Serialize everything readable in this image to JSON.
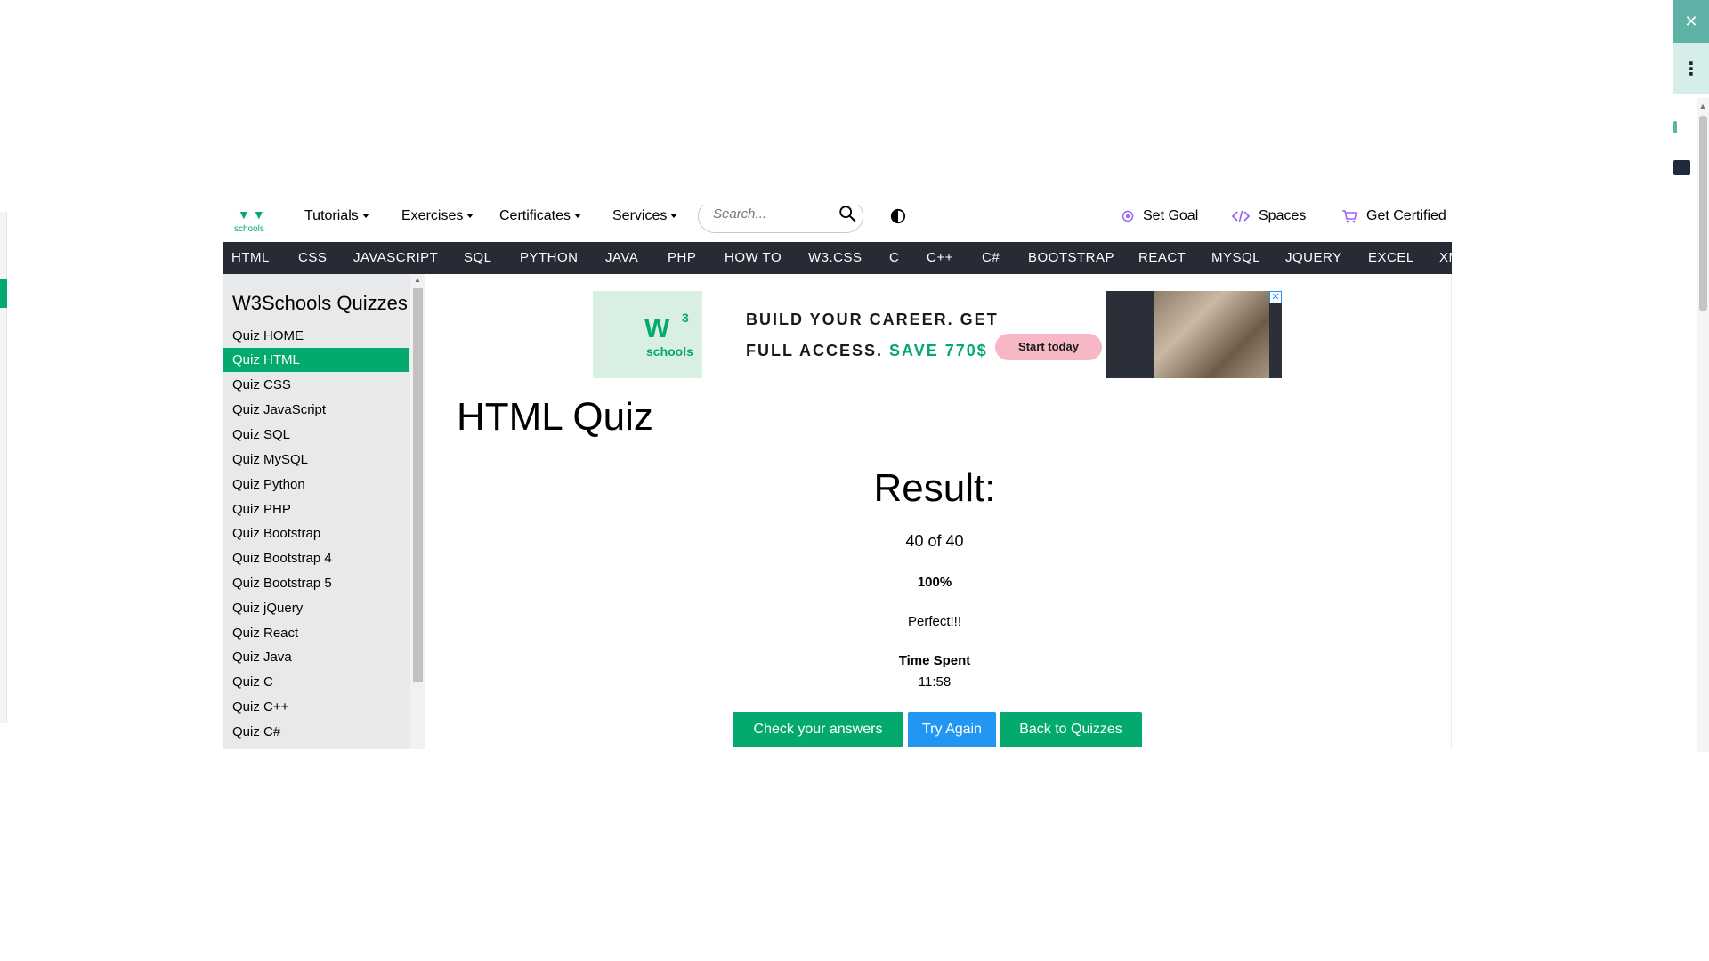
{
  "window_controls": {
    "close_glyph": "✕",
    "menu_glyph": "⋮"
  },
  "logo": {
    "mark": "▼▼",
    "text": "schools"
  },
  "topnav": {
    "items": [
      {
        "label": "Tutorials"
      },
      {
        "label": "Exercises"
      },
      {
        "label": "Certificates"
      },
      {
        "label": "Services"
      }
    ],
    "search_placeholder": "Search...",
    "set_goal": "Set Goal",
    "spaces": "Spaces",
    "get_certified": "Get Certified"
  },
  "subjects": [
    "HTML",
    "CSS",
    "JAVASCRIPT",
    "SQL",
    "PYTHON",
    "JAVA",
    "PHP",
    "HOW TO",
    "W3.CSS",
    "C",
    "C++",
    "C#",
    "BOOTSTRAP",
    "REACT",
    "MYSQL",
    "JQUERY",
    "EXCEL",
    "XM"
  ],
  "sidebar": {
    "title": "W3Schools Quizzes",
    "active_index": 1,
    "items": [
      "Quiz HOME",
      "Quiz HTML",
      "Quiz CSS",
      "Quiz JavaScript",
      "Quiz SQL",
      "Quiz MySQL",
      "Quiz Python",
      "Quiz PHP",
      "Quiz Bootstrap",
      "Quiz Bootstrap 4",
      "Quiz Bootstrap 5",
      "Quiz jQuery",
      "Quiz React",
      "Quiz Java",
      "Quiz C",
      "Quiz C++",
      "Quiz C#"
    ]
  },
  "ad": {
    "logo_main": "W",
    "logo_sup": "3",
    "logo_text": "schools",
    "line1": "BUILD YOUR CAREER. GET",
    "line2_prefix": "FULL ACCESS.",
    "line2_highlight": "SAVE 770$",
    "cta": "Start today",
    "close": "✕"
  },
  "main": {
    "page_title": "HTML Quiz",
    "result_heading": "Result:",
    "score": "40 of 40",
    "percent": "100%",
    "verdict": "Perfect!!!",
    "time_label": "Time Spent",
    "time_value": "11:58"
  },
  "buttons": {
    "check": "Check your answers",
    "try_again": "Try Again",
    "back": "Back to Quizzes"
  },
  "colors": {
    "brand_green": "#04aa6d",
    "subject_bar": "#282a35",
    "sidebar_bg": "#e7e9eb",
    "try_again_blue": "#2196f3",
    "ad_pink": "#f8b7c5"
  }
}
